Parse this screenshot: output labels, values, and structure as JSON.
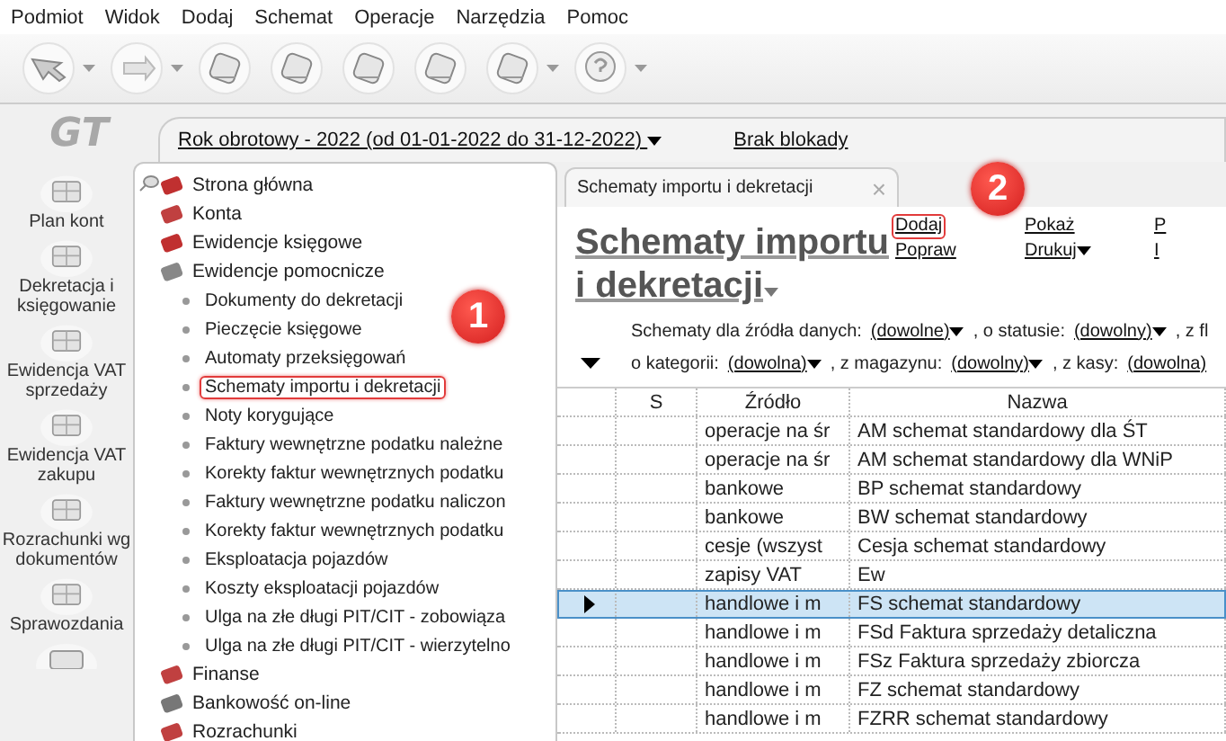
{
  "menu": [
    {
      "label": "Podmiot"
    },
    {
      "label": "Widok"
    },
    {
      "label": "Dodaj"
    },
    {
      "label": "Schemat"
    },
    {
      "label": "Operacje"
    },
    {
      "label": "Narzędzia"
    },
    {
      "label": "Pomoc"
    }
  ],
  "toolbar": [
    {
      "dropdown": true
    },
    {
      "dropdown": true
    },
    {
      "dropdown": false
    },
    {
      "dropdown": false
    },
    {
      "dropdown": false
    },
    {
      "dropdown": false
    },
    {
      "dropdown": true
    },
    {
      "dropdown": true
    }
  ],
  "logo": "GT",
  "period": "Rok obrotowy - 2022  (od 01-01-2022 do 31-12-2022)",
  "lock": "Brak blokady",
  "nav": [
    {
      "label": "Plan kont"
    },
    {
      "label": "Dekretacja i księgowanie"
    },
    {
      "label": "Ewidencja VAT sprzedaży"
    },
    {
      "label": "Ewidencja VAT zakupu"
    },
    {
      "label": "Rozrachunki wg dokumentów"
    },
    {
      "label": "Sprawozdania"
    }
  ],
  "tree": [
    {
      "label": "Strona główna"
    },
    {
      "label": "Konta"
    },
    {
      "label": "Ewidencje księgowe"
    },
    {
      "label": "Ewidencje pomocnicze",
      "children": [
        {
          "label": "Dokumenty do dekretacji",
          "highlighted": false
        },
        {
          "label": "Pieczęcie księgowe",
          "highlighted": false
        },
        {
          "label": "Automaty przeksięgowań",
          "highlighted": false
        },
        {
          "label": "Schematy importu i dekretacji",
          "highlighted": true
        },
        {
          "label": "Noty korygujące",
          "highlighted": false
        },
        {
          "label": "Faktury wewnętrzne podatku należne",
          "highlighted": false
        },
        {
          "label": "Korekty faktur wewnętrznych podatku",
          "highlighted": false
        },
        {
          "label": "Faktury wewnętrzne podatku naliczon",
          "highlighted": false
        },
        {
          "label": "Korekty faktur wewnętrznych podatku",
          "highlighted": false
        },
        {
          "label": "Eksploatacja pojazdów",
          "highlighted": false
        },
        {
          "label": "Koszty eksploatacji pojazdów",
          "highlighted": false
        },
        {
          "label": "Ulga na złe długi PIT/CIT - zobowiąza",
          "highlighted": false
        },
        {
          "label": "Ulga na złe długi PIT/CIT - wierzytelno",
          "highlighted": false
        }
      ]
    },
    {
      "label": "Finanse"
    },
    {
      "label": "Bankowość on-line"
    },
    {
      "label": "Rozrachunki"
    }
  ],
  "callouts": [
    {
      "text": "1"
    },
    {
      "text": "2"
    }
  ],
  "tab": {
    "title": "Schematy importu i dekretacji",
    "close": "×"
  },
  "page_title": "Schematy importu i dekretacji",
  "actions": [
    {
      "label": "Dodaj",
      "highlighted": true,
      "dropdown": false
    },
    {
      "label": "Popraw",
      "highlighted": false,
      "dropdown": false
    },
    {
      "label": "Pokaż",
      "highlighted": false,
      "dropdown": false
    },
    {
      "label": "Drukuj",
      "highlighted": false,
      "dropdown": true
    },
    {
      "label": "P",
      "highlighted": false,
      "dropdown": false
    },
    {
      "label": "I",
      "highlighted": false,
      "dropdown": false
    }
  ],
  "filters": [
    [
      {
        "text": "Schematy dla źródła danych:"
      },
      {
        "value": "(dowolne)",
        "dropdown": true
      },
      {
        "text": ", o statusie:"
      },
      {
        "value": "(dowolny)",
        "dropdown": true
      },
      {
        "text": ", z fl"
      }
    ],
    [
      {
        "text": "o kategorii:"
      },
      {
        "value": "(dowolna)",
        "dropdown": true
      },
      {
        "text": ", z magazynu:"
      },
      {
        "value": "(dowolny)",
        "dropdown": true
      },
      {
        "text": ", z kasy:"
      },
      {
        "value": "(dowolna)",
        "dropdown": false
      }
    ]
  ],
  "table": {
    "columns": [
      "S",
      "Źródło",
      "Nazwa"
    ],
    "rows": [
      {
        "s": "",
        "source": "operacje na śr",
        "name": "AM schemat standardowy dla ŚT",
        "selected": false
      },
      {
        "s": "",
        "source": "operacje na śr",
        "name": "AM schemat standardowy dla WNiP",
        "selected": false
      },
      {
        "s": "",
        "source": "bankowe",
        "name": "BP schemat standardowy",
        "selected": false
      },
      {
        "s": "",
        "source": "bankowe",
        "name": "BW schemat standardowy",
        "selected": false
      },
      {
        "s": "",
        "source": "cesje (wszyst",
        "name": "Cesja schemat standardowy",
        "selected": false
      },
      {
        "s": "",
        "source": "zapisy VAT",
        "name": "Ew",
        "selected": false
      },
      {
        "s": "",
        "source": "handlowe i m",
        "name": "FS schemat standardowy",
        "selected": true
      },
      {
        "s": "",
        "source": "handlowe i m",
        "name": "FSd Faktura sprzedaży detaliczna",
        "selected": false
      },
      {
        "s": "",
        "source": "handlowe i m",
        "name": "FSz Faktura sprzedaży zbiorcza",
        "selected": false
      },
      {
        "s": "",
        "source": "handlowe i m",
        "name": "FZ schemat standardowy",
        "selected": false
      },
      {
        "s": "",
        "source": "handlowe i m",
        "name": "FZRR schemat standardowy",
        "selected": false
      }
    ]
  }
}
